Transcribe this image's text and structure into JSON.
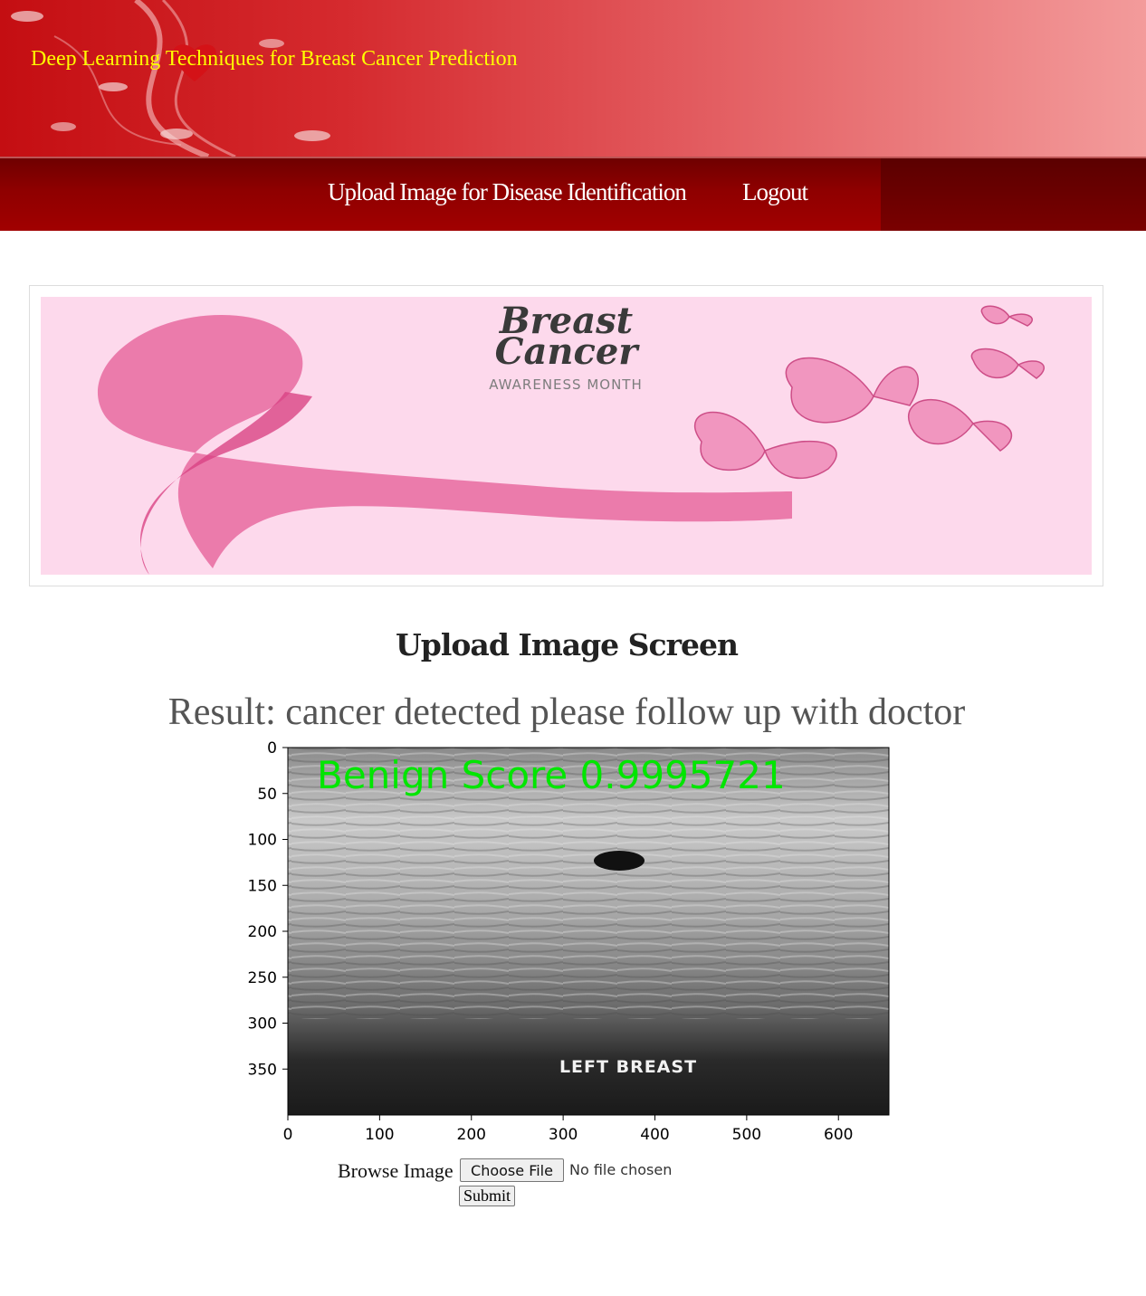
{
  "header": {
    "title": "Deep Learning Techniques for Breast Cancer Prediction"
  },
  "nav": {
    "items": [
      {
        "label": "Upload Image for Disease Identification"
      },
      {
        "label": "Logout"
      }
    ]
  },
  "banner": {
    "title_line1": "Breast",
    "title_line2": "Cancer",
    "subtitle": "AWARENESS MONTH"
  },
  "main": {
    "heading": "Upload Image Screen",
    "result": "Result: cancer detected please follow up with doctor"
  },
  "plot": {
    "overlay_text": "Benign  Score  0.9995721",
    "image_caption": "LEFT BREAST",
    "x_ticks": [
      "0",
      "100",
      "200",
      "300",
      "400",
      "500",
      "600"
    ],
    "y_ticks": [
      "0",
      "50",
      "100",
      "150",
      "200",
      "250",
      "300",
      "350"
    ],
    "overlay_color": "#00e600"
  },
  "form": {
    "browse_label": "Browse Image",
    "choose_file_label": "Choose File",
    "file_status": "No file chosen",
    "submit_label": "Submit"
  }
}
